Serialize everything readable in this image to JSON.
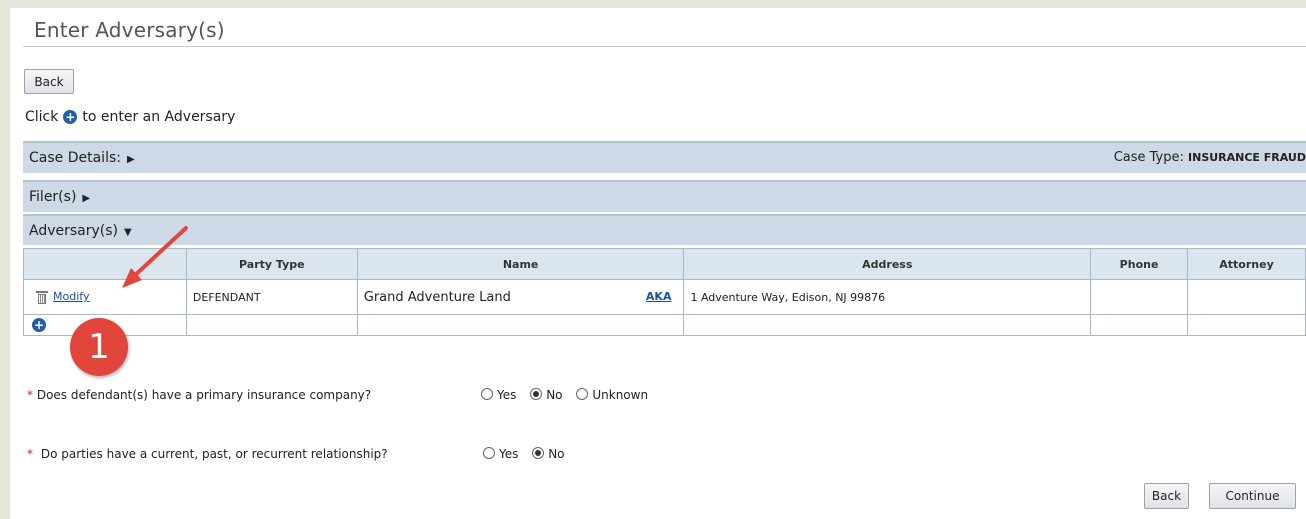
{
  "page": {
    "title": "Enter Adversary(s)"
  },
  "buttons": {
    "back_top": "Back",
    "back_bottom": "Back",
    "continue": "Continue"
  },
  "instruction": {
    "before": "Click",
    "after": "to enter an Adversary",
    "icon": "plus-circle-icon"
  },
  "sections": {
    "case_details": "Case Details:",
    "case_type_label": "Case Type:",
    "case_type_value": "INSURANCE FRAUD",
    "filers": "Filer(s)",
    "adversaries": "Adversary(s)"
  },
  "table": {
    "columns": [
      "",
      "Party Type",
      "Name",
      "Address",
      "Phone",
      "Attorney"
    ],
    "rows": [
      {
        "action": "Modify",
        "party_type": "DEFENDANT",
        "name": "Grand Adventure Land",
        "aka": "AKA",
        "address": "1 Adventure Way, Edison, NJ 99876",
        "phone": "",
        "attorney": ""
      }
    ]
  },
  "questions": [
    {
      "text": "Does defendant(s) have a primary insurance company?",
      "options": [
        "Yes",
        "No",
        "Unknown"
      ],
      "selected": "No"
    },
    {
      "text": "Do parties have a current, past, or recurrent relationship?",
      "options": [
        "Yes",
        "No"
      ],
      "selected": "No"
    }
  ],
  "callout": {
    "number": "1"
  },
  "colors": {
    "section_bar": "#cdd9e6",
    "link": "#1b4fa0",
    "callout": "#e2453b",
    "required": "#dd2222"
  }
}
